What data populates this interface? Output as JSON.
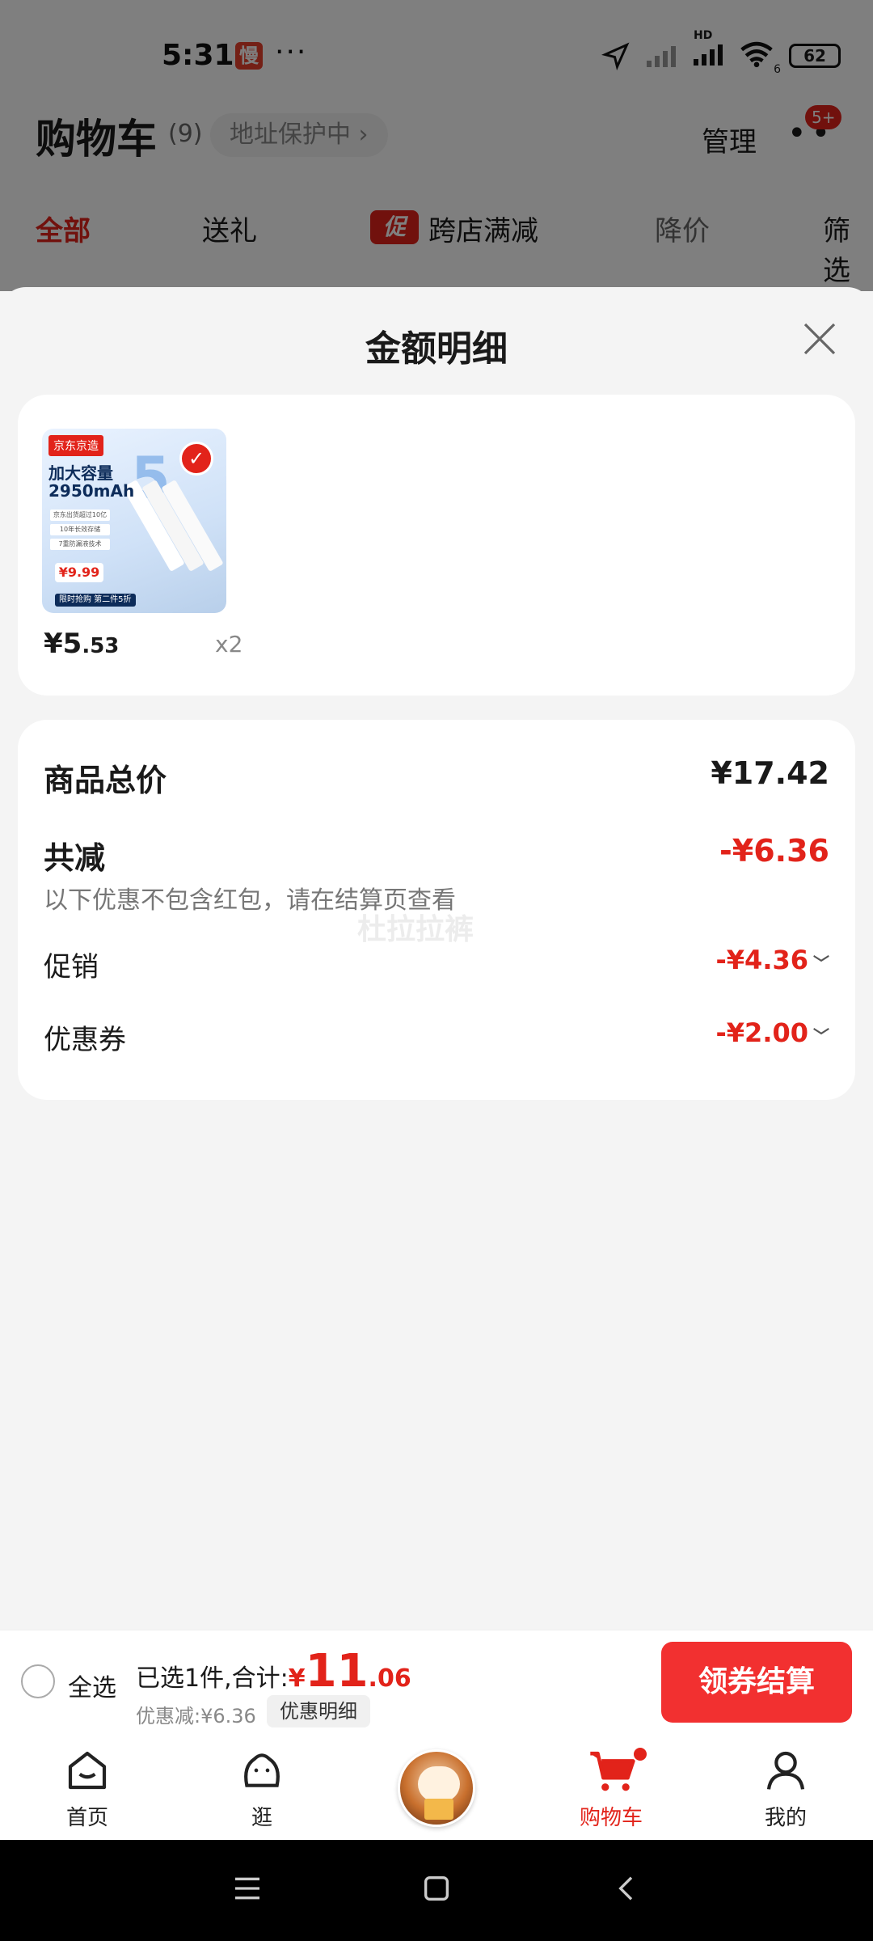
{
  "status_bar": {
    "time": "5:31",
    "app_badge": "慢",
    "dots": "···",
    "network": "HD",
    "wifi_label": "6",
    "battery": "62"
  },
  "cart_header": {
    "title": "购物车",
    "count": "(9)",
    "address_chip": "地址保护中 ›",
    "manage": "管理",
    "more_badge": "5+"
  },
  "filters": {
    "all": "全部",
    "gift": "送礼",
    "promo_tag": "促",
    "promo": "跨店满减",
    "price_drop": "降价",
    "filter": "筛选"
  },
  "sheet": {
    "title": "金额明细",
    "product": {
      "brand": "京东京造",
      "capacity_line1": "加大容量",
      "capacity_line2": "2950mAh",
      "features": [
        "京东出货超过10亿",
        "10年长效存储",
        "7重防漏液技术"
      ],
      "tag_price": "¥9.99",
      "promo_tag": "限时抢购 第二件5折",
      "price_yen": "¥5",
      "price_dec": ".53",
      "qty": "x2"
    },
    "summary": {
      "total_label": "商品总价",
      "total_value": "¥17.42",
      "reduce_label": "共减",
      "reduce_value": "-¥6.36",
      "note": "以下优惠不包含红包，请在结算页查看",
      "promo_label": "促销",
      "promo_value": "-¥4.36",
      "coupon_label": "优惠券",
      "coupon_value": "-¥2.00",
      "watermark": "杜拉拉裤"
    }
  },
  "checkout": {
    "select_all": "全选",
    "selected_text": "已选1件,合计:",
    "total_yen": "¥",
    "total_int": "11",
    "total_dec": ".06",
    "discount_text": "优惠减:¥6.36",
    "detail_chip": "优惠明细",
    "pay_button": "领券结算"
  },
  "tabbar": {
    "home": "首页",
    "browse": "逛",
    "cart": "购物车",
    "me": "我的"
  },
  "colors": {
    "accent": "#e2231a",
    "button": "#f23030",
    "sheet_bg": "#f4f4f4"
  }
}
